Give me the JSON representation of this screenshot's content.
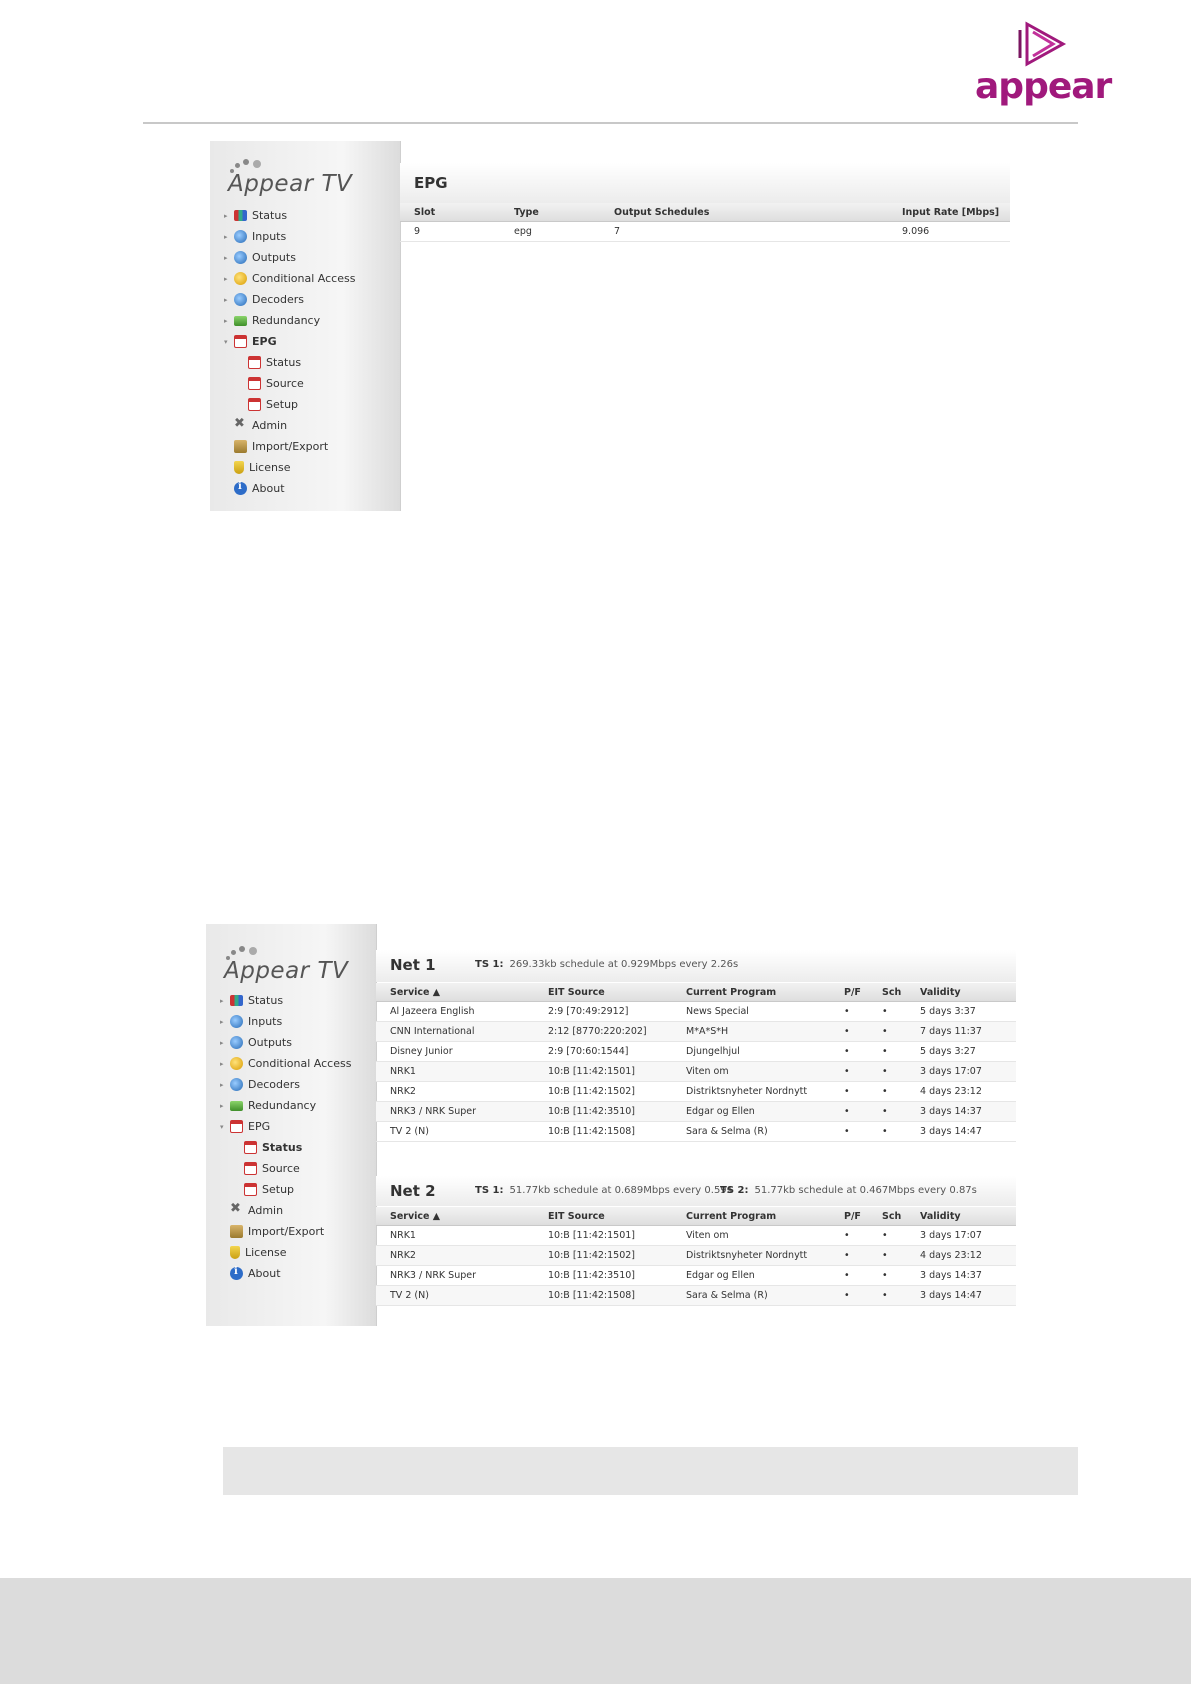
{
  "header": {
    "logo_text": "appear",
    "accent": "#a0197c"
  },
  "shot1": {
    "brand": "Appear TV",
    "sidebar": [
      {
        "label": "Status",
        "icon": "status-chart-icon",
        "arrow": "▸"
      },
      {
        "label": "Inputs",
        "icon": "inputs-icon",
        "arrow": "▸"
      },
      {
        "label": "Outputs",
        "icon": "outputs-icon",
        "arrow": "▸"
      },
      {
        "label": "Conditional Access",
        "icon": "conditional-access-icon",
        "arrow": "▸"
      },
      {
        "label": "Decoders",
        "icon": "decoders-icon",
        "arrow": "▸"
      },
      {
        "label": "Redundancy",
        "icon": "redundancy-icon",
        "arrow": "▸"
      },
      {
        "label": "EPG",
        "icon": "epg-calendar-icon",
        "arrow": "▾"
      },
      {
        "label": "Status",
        "icon": "epg-calendar-icon"
      },
      {
        "label": "Source",
        "icon": "epg-calendar-icon"
      },
      {
        "label": "Setup",
        "icon": "epg-calendar-icon"
      },
      {
        "label": "Admin",
        "icon": "admin-tools-icon"
      },
      {
        "label": "Import/Export",
        "icon": "import-export-icon"
      },
      {
        "label": "License",
        "icon": "license-icon"
      },
      {
        "label": "About",
        "icon": "about-info-icon"
      }
    ],
    "title": "EPG",
    "table": {
      "headers": [
        "Slot",
        "Type",
        "Output Schedules",
        "Input Rate [Mbps]"
      ],
      "rows": [
        [
          "9",
          "epg",
          "7",
          "9.096"
        ]
      ]
    }
  },
  "shot2": {
    "brand": "Appear TV",
    "sidebar": [
      {
        "label": "Status",
        "icon": "status-chart-icon",
        "arrow": "▸"
      },
      {
        "label": "Inputs",
        "icon": "inputs-icon",
        "arrow": "▸"
      },
      {
        "label": "Outputs",
        "icon": "outputs-icon",
        "arrow": "▸"
      },
      {
        "label": "Conditional Access",
        "icon": "conditional-access-icon",
        "arrow": "▸"
      },
      {
        "label": "Decoders",
        "icon": "decoders-icon",
        "arrow": "▸"
      },
      {
        "label": "Redundancy",
        "icon": "redundancy-icon",
        "arrow": "▸"
      },
      {
        "label": "EPG",
        "icon": "epg-calendar-icon",
        "arrow": "▾"
      },
      {
        "label": "Status",
        "icon": "epg-calendar-icon"
      },
      {
        "label": "Source",
        "icon": "epg-calendar-icon"
      },
      {
        "label": "Setup",
        "icon": "epg-calendar-icon"
      },
      {
        "label": "Admin",
        "icon": "admin-tools-icon"
      },
      {
        "label": "Import/Export",
        "icon": "import-export-icon"
      },
      {
        "label": "License",
        "icon": "license-icon"
      },
      {
        "label": "About",
        "icon": "about-info-icon"
      }
    ],
    "net1": {
      "title": "Net 1",
      "ts1_label": "TS 1:",
      "ts1_text": "269.33kb schedule at 0.929Mbps every 2.26s",
      "headers": [
        "Service ▲",
        "EIT Source",
        "Current Program",
        "P/F",
        "Sch",
        "Validity"
      ],
      "rows": [
        [
          "Al Jazeera English",
          "2:9 [70:49:2912]",
          "News Special",
          "•",
          "•",
          "5 days 3:37"
        ],
        [
          "CNN International",
          "2:12 [8770:220:202]",
          "M*A*S*H",
          "•",
          "•",
          "7 days 11:37"
        ],
        [
          "Disney Junior",
          "2:9 [70:60:1544]",
          "Djungelhjul",
          "•",
          "•",
          "5 days 3:27"
        ],
        [
          "NRK1",
          "10:B [11:42:1501]",
          "Viten om",
          "•",
          "•",
          "3 days 17:07"
        ],
        [
          "NRK2",
          "10:B [11:42:1502]",
          "Distriktsnyheter Nordnytt",
          "•",
          "•",
          "4 days 23:12"
        ],
        [
          "NRK3 / NRK Super",
          "10:B [11:42:3510]",
          "Edgar og Ellen",
          "•",
          "•",
          "3 days 14:37"
        ],
        [
          "TV 2 (N)",
          "10:B [11:42:1508]",
          "Sara & Selma (R)",
          "•",
          "•",
          "3 days 14:47"
        ]
      ]
    },
    "net2": {
      "title": "Net 2",
      "ts1_label": "TS 1:",
      "ts1_text": "51.77kb schedule at 0.689Mbps every 0.59s",
      "ts2_label": "TS 2:",
      "ts2_text": "51.77kb schedule at 0.467Mbps every 0.87s",
      "headers": [
        "Service ▲",
        "EIT Source",
        "Current Program",
        "P/F",
        "Sch",
        "Validity"
      ],
      "rows": [
        [
          "NRK1",
          "10:B [11:42:1501]",
          "Viten om",
          "•",
          "•",
          "3 days 17:07"
        ],
        [
          "NRK2",
          "10:B [11:42:1502]",
          "Distriktsnyheter Nordnytt",
          "•",
          "•",
          "4 days 23:12"
        ],
        [
          "NRK3 / NRK Super",
          "10:B [11:42:3510]",
          "Edgar og Ellen",
          "•",
          "•",
          "3 days 14:37"
        ],
        [
          "TV 2 (N)",
          "10:B [11:42:1508]",
          "Sara & Selma (R)",
          "•",
          "•",
          "3 days 14:47"
        ]
      ]
    }
  }
}
